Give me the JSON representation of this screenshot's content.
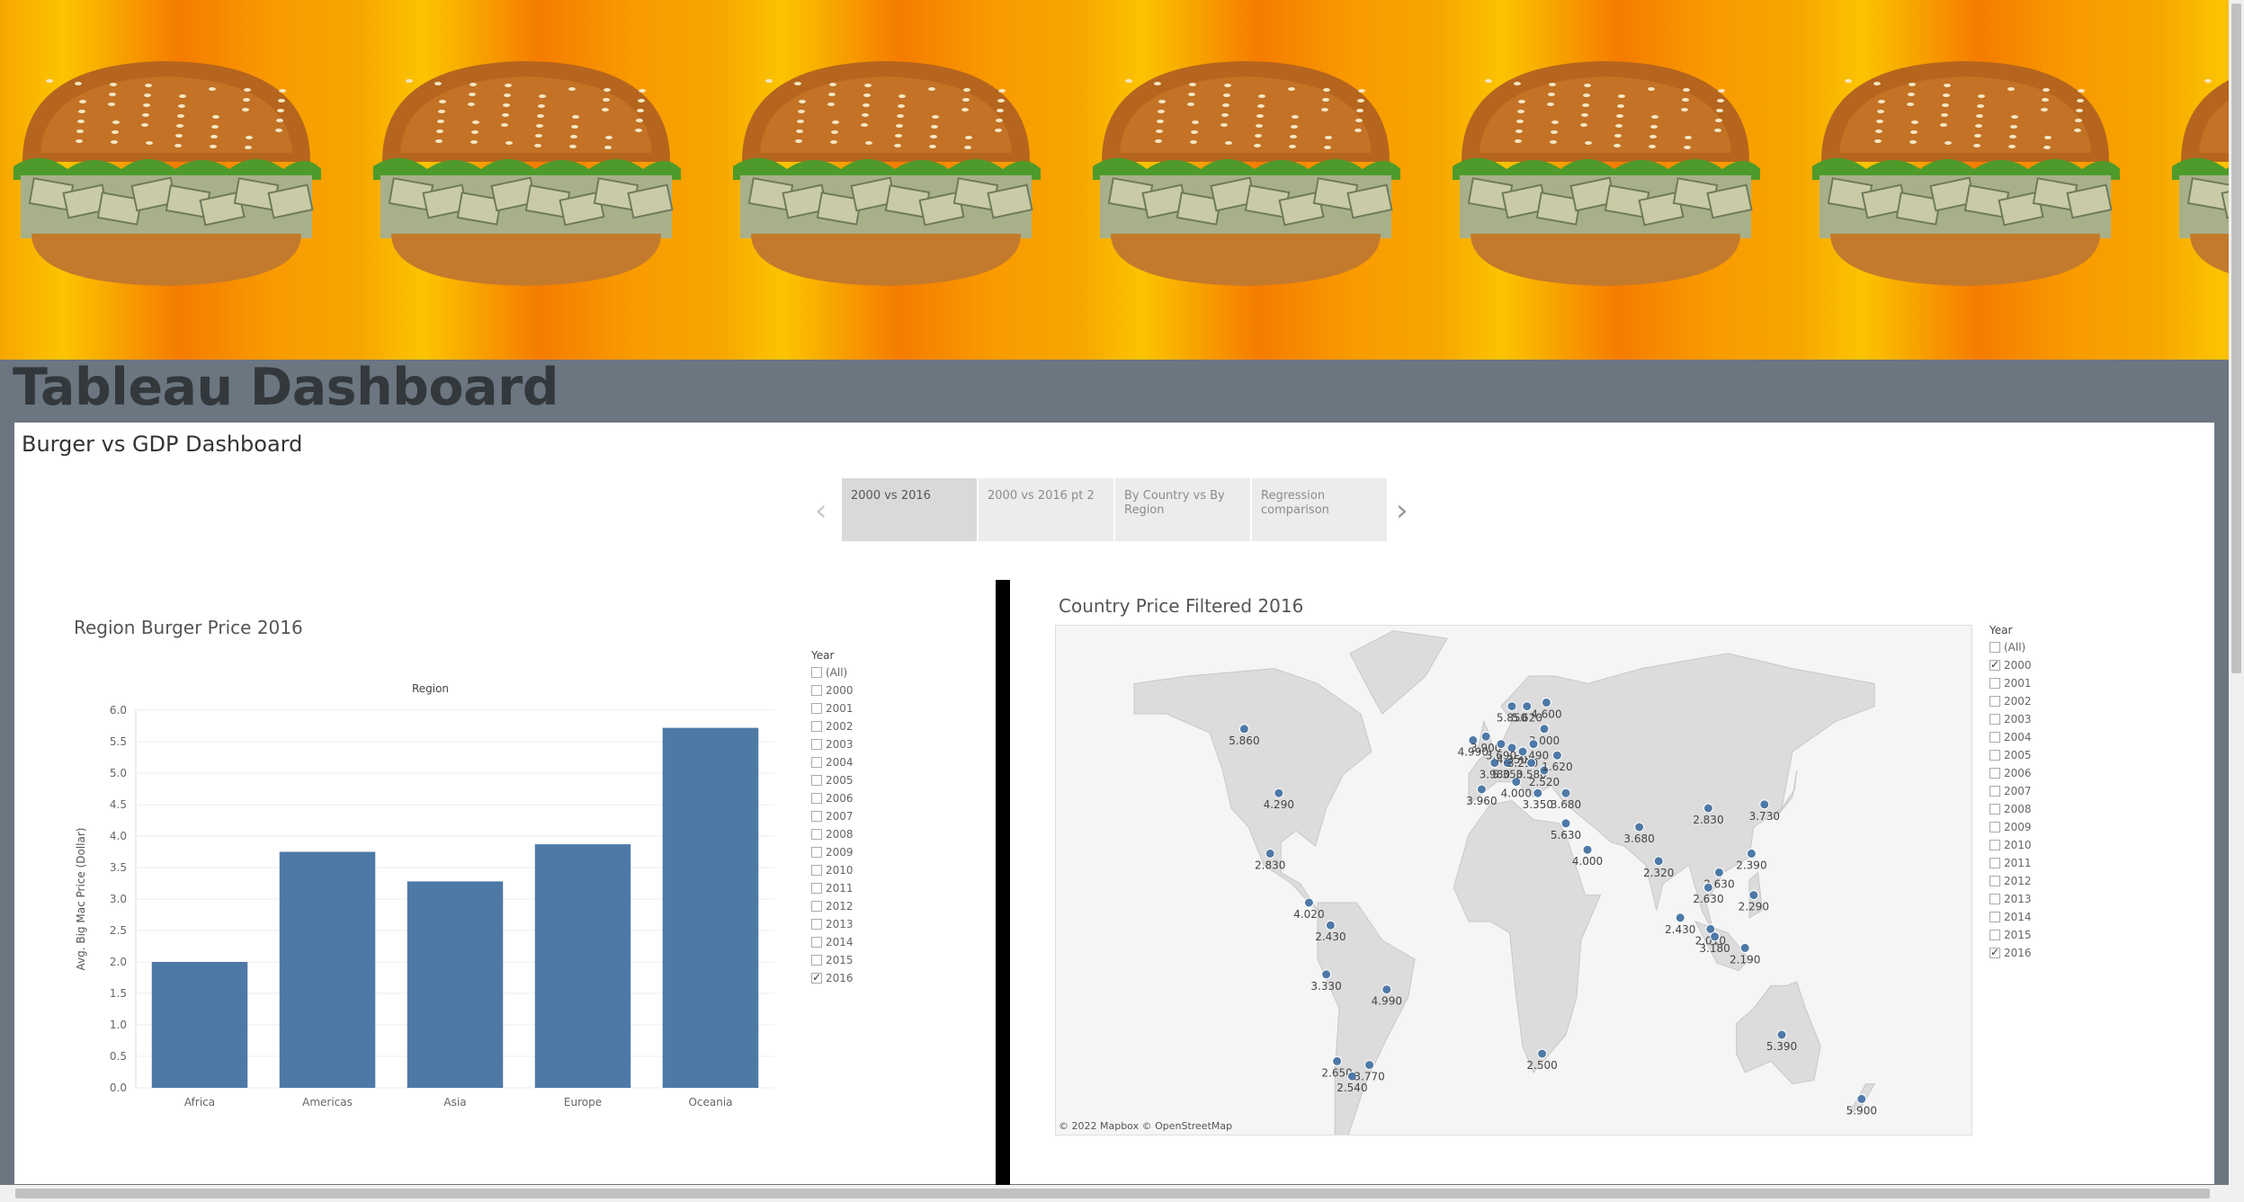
{
  "page": {
    "heading": "Tableau Dashboard"
  },
  "dashboard": {
    "title": "Burger vs GDP Dashboard",
    "tabs": [
      {
        "label": "2000 vs 2016",
        "active": true
      },
      {
        "label": "2000 vs 2016 pt 2"
      },
      {
        "label": "By Country vs By Region"
      },
      {
        "label": "Regression comparison"
      }
    ]
  },
  "bar_sheet": {
    "title": "Region Burger Price 2016"
  },
  "map_sheet": {
    "title": "Country Price Filtered 2016",
    "credit": "© 2022 Mapbox  © OpenStreetMap"
  },
  "year_filter_left": {
    "title": "Year",
    "items": [
      {
        "label": "(All)",
        "checked": false
      },
      {
        "label": "2000",
        "checked": false
      },
      {
        "label": "2001",
        "checked": false
      },
      {
        "label": "2002",
        "checked": false
      },
      {
        "label": "2003",
        "checked": false
      },
      {
        "label": "2004",
        "checked": false
      },
      {
        "label": "2005",
        "checked": false
      },
      {
        "label": "2006",
        "checked": false
      },
      {
        "label": "2007",
        "checked": false
      },
      {
        "label": "2008",
        "checked": false
      },
      {
        "label": "2009",
        "checked": false
      },
      {
        "label": "2010",
        "checked": false
      },
      {
        "label": "2011",
        "checked": false
      },
      {
        "label": "2012",
        "checked": false
      },
      {
        "label": "2013",
        "checked": false
      },
      {
        "label": "2014",
        "checked": false
      },
      {
        "label": "2015",
        "checked": false
      },
      {
        "label": "2016",
        "checked": true
      }
    ]
  },
  "year_filter_right": {
    "title": "Year",
    "items": [
      {
        "label": "(All)",
        "checked": false
      },
      {
        "label": "2000",
        "checked": true
      },
      {
        "label": "2001",
        "checked": false
      },
      {
        "label": "2002",
        "checked": false
      },
      {
        "label": "2003",
        "checked": false
      },
      {
        "label": "2004",
        "checked": false
      },
      {
        "label": "2005",
        "checked": false
      },
      {
        "label": "2006",
        "checked": false
      },
      {
        "label": "2007",
        "checked": false
      },
      {
        "label": "2008",
        "checked": false
      },
      {
        "label": "2009",
        "checked": false
      },
      {
        "label": "2010",
        "checked": false
      },
      {
        "label": "2011",
        "checked": false
      },
      {
        "label": "2012",
        "checked": false
      },
      {
        "label": "2013",
        "checked": false
      },
      {
        "label": "2014",
        "checked": false
      },
      {
        "label": "2015",
        "checked": false
      },
      {
        "label": "2016",
        "checked": true
      }
    ]
  },
  "chart_data": [
    {
      "type": "bar",
      "title": "Region Burger Price 2016",
      "xlabel": "Region",
      "ylabel": "Avg. Big Mac Price (Dollar)",
      "categories": [
        "Africa",
        "Americas",
        "Asia",
        "Europe",
        "Oceania"
      ],
      "values": [
        2.0,
        3.75,
        3.28,
        3.87,
        5.72
      ],
      "ylim": [
        0,
        6.0
      ],
      "yticks": [
        "0.0",
        "0.5",
        "1.0",
        "1.5",
        "2.0",
        "2.5",
        "3.0",
        "3.5",
        "4.0",
        "4.5",
        "5.0",
        "5.5",
        "6.0"
      ],
      "color": "#4e79a7",
      "grid": true
    },
    {
      "type": "scatter",
      "title": "Country Price Filtered 2016",
      "color": "#4e79a7",
      "points": [
        {
          "lon": -114,
          "lat": 56,
          "label": "5.860"
        },
        {
          "lon": -98,
          "lat": 39,
          "label": "4.290"
        },
        {
          "lon": -102,
          "lat": 23,
          "label": "2.830"
        },
        {
          "lon": -84,
          "lat": 10,
          "label": "4.020"
        },
        {
          "lon": -74,
          "lat": 4,
          "label": "2.430"
        },
        {
          "lon": -76,
          "lat": -9,
          "label": "3.330"
        },
        {
          "lon": -71,
          "lat": -32,
          "label": "2.650"
        },
        {
          "lon": -64,
          "lat": -36,
          "label": "2.540"
        },
        {
          "lon": -56,
          "lat": -33,
          "label": "3.770"
        },
        {
          "lon": -48,
          "lat": -13,
          "label": "4.990"
        },
        {
          "lon": -8,
          "lat": 53,
          "label": "4.990"
        },
        {
          "lon": -4,
          "lat": 40,
          "label": "3.960"
        },
        {
          "lon": -2,
          "lat": 54,
          "label": "3.900"
        },
        {
          "lon": 2,
          "lat": 47,
          "label": "3.980"
        },
        {
          "lon": 12,
          "lat": 42,
          "label": "4.000"
        },
        {
          "lon": 8,
          "lat": 47,
          "label": "5.350"
        },
        {
          "lon": 10,
          "lat": 51,
          "label": "4.350"
        },
        {
          "lon": 5,
          "lat": 52,
          "label": "3.690"
        },
        {
          "lon": 10,
          "lat": 62,
          "label": "5.850"
        },
        {
          "lon": 17,
          "lat": 62,
          "label": "5.620"
        },
        {
          "lon": 26,
          "lat": 63,
          "label": "4.600"
        },
        {
          "lon": 25,
          "lat": 56,
          "label": "3.000"
        },
        {
          "lon": 20,
          "lat": 52,
          "label": "2.490"
        },
        {
          "lon": 15,
          "lat": 50,
          "label": "3.290"
        },
        {
          "lon": 19,
          "lat": 47,
          "label": "3.580"
        },
        {
          "lon": 25,
          "lat": 45,
          "label": "2.520"
        },
        {
          "lon": 31,
          "lat": 49,
          "label": "1.620"
        },
        {
          "lon": 22,
          "lat": 39,
          "label": "3.350"
        },
        {
          "lon": 35,
          "lat": 39,
          "label": "3.680"
        },
        {
          "lon": 35,
          "lat": 31,
          "label": "5.630"
        },
        {
          "lon": 45,
          "lat": 24,
          "label": "4.000"
        },
        {
          "lon": 69,
          "lat": 30,
          "label": "3.680"
        },
        {
          "lon": 78,
          "lat": 21,
          "label": "2.320"
        },
        {
          "lon": 101,
          "lat": 35,
          "label": "2.830"
        },
        {
          "lon": 127,
          "lat": 36,
          "label": "3.730"
        },
        {
          "lon": 121,
          "lat": 23,
          "label": "2.390"
        },
        {
          "lon": 106,
          "lat": 18,
          "label": "2.630"
        },
        {
          "lon": 101,
          "lat": 14,
          "label": "2.630"
        },
        {
          "lon": 102,
          "lat": 3,
          "label": "2.010"
        },
        {
          "lon": 104,
          "lat": 1,
          "label": "3.180"
        },
        {
          "lon": 118,
          "lat": -2,
          "label": "2.190"
        },
        {
          "lon": 122,
          "lat": 12,
          "label": "2.290"
        },
        {
          "lon": 88,
          "lat": 6,
          "label": "2.430"
        },
        {
          "lon": 135,
          "lat": -25,
          "label": "5.390"
        },
        {
          "lon": 172,
          "lat": -42,
          "label": "5.900"
        },
        {
          "lon": 24,
          "lat": -30,
          "label": "2.500"
        }
      ]
    }
  ]
}
